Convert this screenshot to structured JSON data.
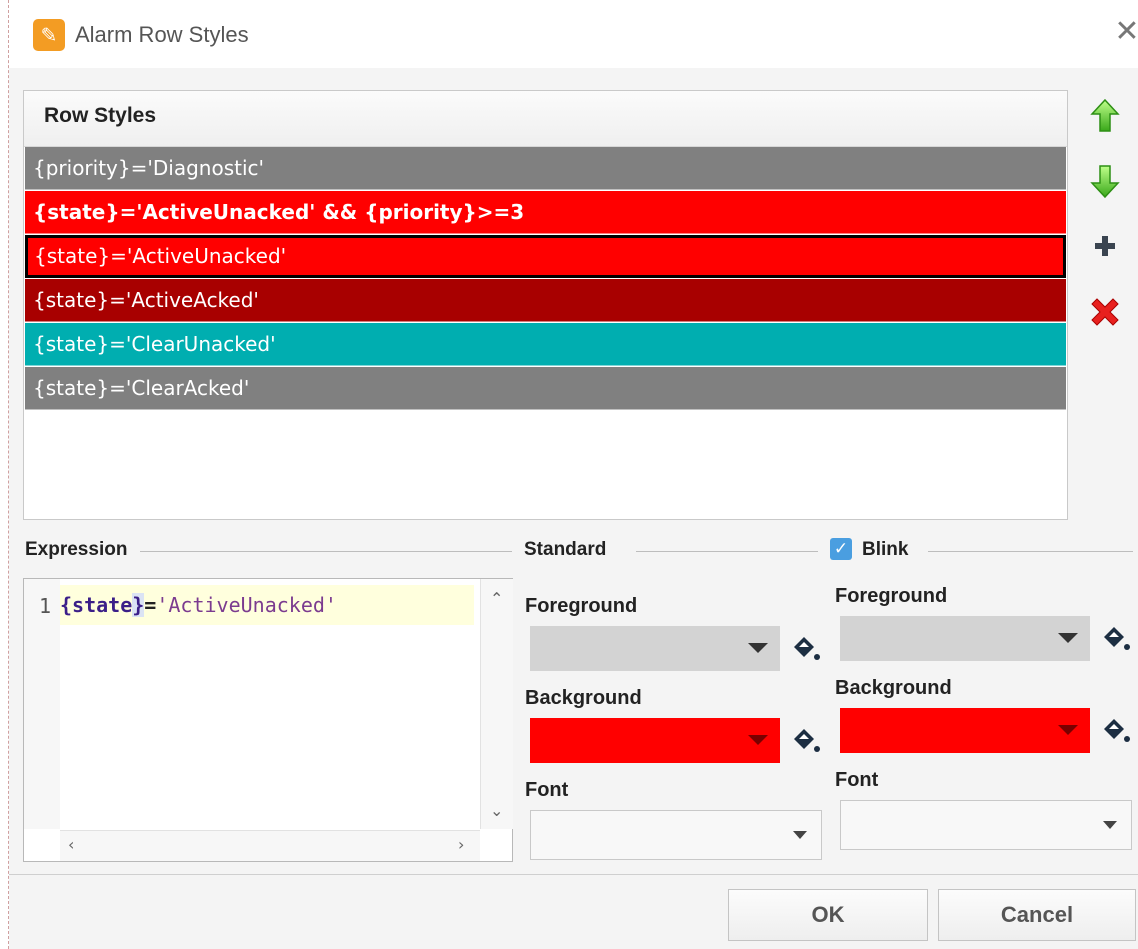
{
  "window": {
    "title": "Alarm Row Styles",
    "close_glyph": "✕",
    "app_icon": "pencil-brush-icon"
  },
  "row_styles": {
    "header": "Row Styles",
    "rows": [
      {
        "text": "{priority}='Diagnostic'",
        "color": "#808080",
        "bold": false,
        "selected": false
      },
      {
        "text": "{state}='ActiveUnacked' && {priority}>=3",
        "color": "#ff0000",
        "bold": true,
        "selected": false
      },
      {
        "text": "{state}='ActiveUnacked'",
        "color": "#ff0000",
        "bold": false,
        "selected": true
      },
      {
        "text": "{state}='ActiveAcked'",
        "color": "#a80000",
        "bold": false,
        "selected": false
      },
      {
        "text": "{state}='ClearUnacked'",
        "color": "#00aeb0",
        "bold": false,
        "selected": false
      },
      {
        "text": "{state}='ClearAcked'",
        "color": "#808080",
        "bold": false,
        "selected": false
      }
    ],
    "actions": [
      "move-up-icon",
      "move-down-icon",
      "add-icon",
      "delete-icon"
    ]
  },
  "expression": {
    "label": "Expression",
    "line_number": "1",
    "tokens": [
      "{state",
      "}",
      "=",
      "'ActiveUnacked'"
    ]
  },
  "standard": {
    "label": "Standard",
    "foreground_label": "Foreground",
    "foreground_color": "#d3d3d3",
    "background_label": "Background",
    "background_color": "#ff0000",
    "font_label": "Font"
  },
  "blink": {
    "label": "Blink",
    "checked": true,
    "foreground_label": "Foreground",
    "foreground_color": "#d3d3d3",
    "background_label": "Background",
    "background_color": "#ff0000",
    "font_label": "Font"
  },
  "buttons": {
    "ok": "OK",
    "cancel": "Cancel"
  }
}
